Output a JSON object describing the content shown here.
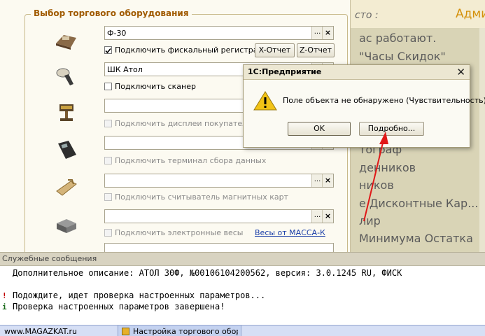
{
  "right_panel": {
    "header_left": "сто :",
    "header_right": "Адми",
    "items": [
      "ас работают.",
      "\"Часы Скидок\"",
      "",
      "",
      "",
      "тограф",
      "денников",
      "ников",
      "е Дисконтные Кар...",
      "лир",
      "Минимума Остатка"
    ]
  },
  "settings": {
    "group_title": "Выбор торгового оборудования",
    "fiscal": {
      "value": "Ф-30",
      "checkbox_label": "Подключить фискальный регистратор",
      "checked": true,
      "x_report": "X-Отчет",
      "z_report": "Z-Отчет"
    },
    "scanner": {
      "value": "ШК Атол",
      "checkbox_label": "Подключить сканер",
      "checked": false
    },
    "customer_display": {
      "value": "",
      "checkbox_label": "Подключить дисплеи покупателя"
    },
    "data_terminal": {
      "value": "",
      "checkbox_label": "Подключить терминал сбора данных"
    },
    "card_reader": {
      "value": "",
      "checkbox_label": "Подключить считыватель магнитных карт"
    },
    "scales": {
      "value": "",
      "checkbox_label": "Подключить электронные весы",
      "link": "Весы от МАССА-К"
    },
    "dropdown_glyph": "...",
    "clear_glyph": "×"
  },
  "dialog": {
    "title": "1С:Предприятие",
    "close": "✕",
    "message": "Поле объекта не обнаружено (Чувствительность)",
    "ok": "OK",
    "details": "Подробно..."
  },
  "messages": {
    "title": "Служебные сообщения",
    "lines": [
      {
        "mark": "",
        "text": "Дополнительное описание: АТОЛ 30Ф, №00106104200562, версия: 3.0.1245 RU, ФИСК"
      },
      {
        "mark": "!",
        "text": "Подождите, идет проверка настроенных параметров..."
      },
      {
        "mark": "i",
        "text": "Проверка настроенных параметров завершена!"
      }
    ]
  },
  "taskbar": {
    "items": [
      "www.MAGAZKAT.ru",
      "Настройка торгового обору..."
    ]
  },
  "colors": {
    "group_title": "#a05a00",
    "accent": "#d4900a",
    "arrow": "#e01818",
    "link": "#1a3ea8"
  }
}
